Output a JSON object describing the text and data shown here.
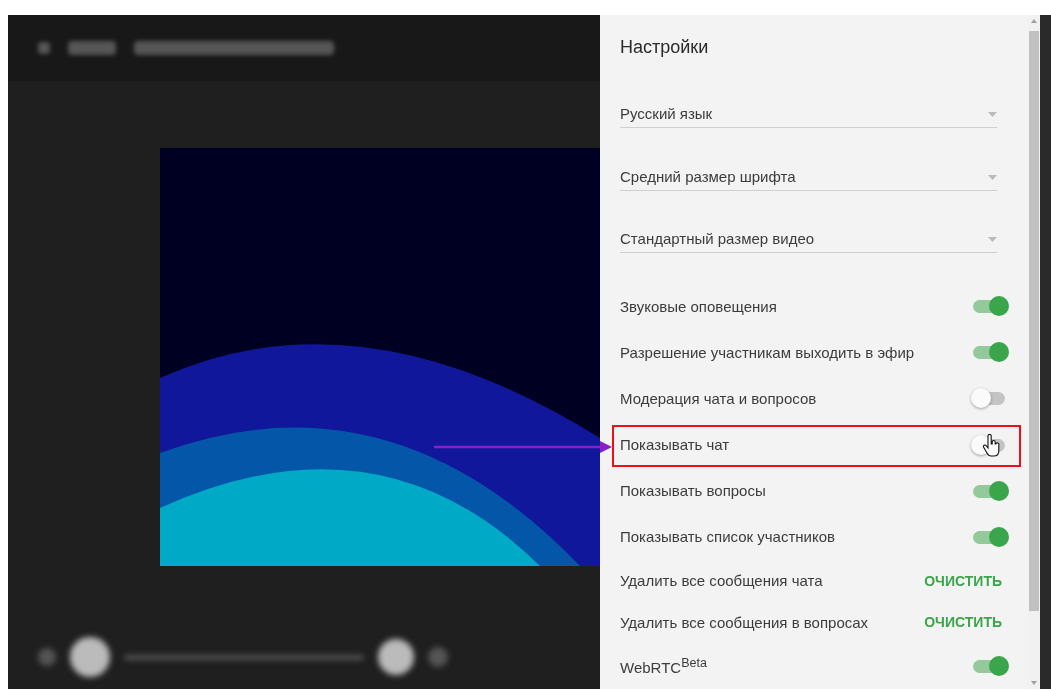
{
  "settings": {
    "title": "Настройки",
    "items": [
      {
        "kind": "select",
        "label": "Русский язык",
        "highlighted": false
      },
      {
        "kind": "select",
        "label": "Средний размер шрифта",
        "highlighted": false
      },
      {
        "kind": "select",
        "label": "Стандартный размер видео",
        "highlighted": false
      },
      {
        "kind": "toggle",
        "label": "Звуковые оповещения",
        "on": true,
        "highlighted": false
      },
      {
        "kind": "toggle",
        "label": "Разрешение участникам выходить в эфир",
        "on": true,
        "highlighted": false
      },
      {
        "kind": "toggle",
        "label": "Модерация чата и вопросов",
        "on": false,
        "highlighted": false
      },
      {
        "kind": "toggle",
        "label": "Показывать чат",
        "on": false,
        "highlighted": true
      },
      {
        "kind": "toggle",
        "label": "Показывать вопросы",
        "on": true,
        "highlighted": false
      },
      {
        "kind": "toggle",
        "label": "Показывать список участников",
        "on": true,
        "highlighted": false
      },
      {
        "kind": "action",
        "label": "Удалить все сообщения чата",
        "action": "ОЧИСТИТЬ",
        "highlighted": false
      },
      {
        "kind": "action",
        "label": "Удалить все сообщения в вопросах",
        "action": "ОЧИСТИТЬ",
        "highlighted": false
      },
      {
        "kind": "toggle",
        "label": "WebRTC$^{Beta}$",
        "on": true,
        "highlighted": false
      }
    ]
  }
}
